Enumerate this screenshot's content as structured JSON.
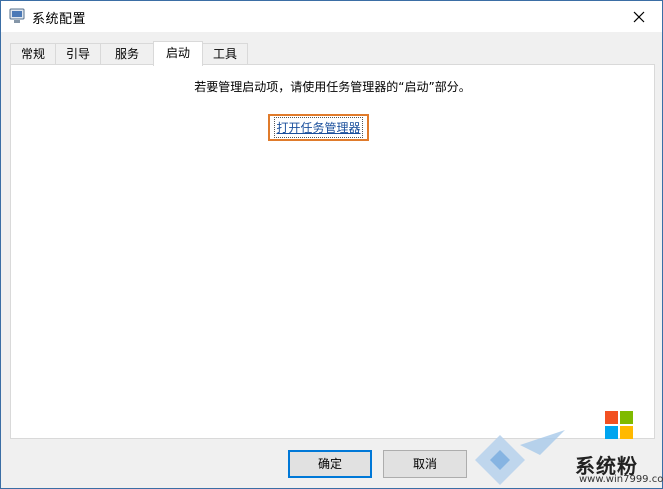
{
  "window": {
    "title": "系统配置"
  },
  "tabs": [
    {
      "label": "常规"
    },
    {
      "label": "引导"
    },
    {
      "label": "服务"
    },
    {
      "label": "启动"
    },
    {
      "label": "工具"
    }
  ],
  "active_tab": "启动",
  "panel": {
    "message": "若要管理启动项，请使用任务管理器的“启动”部分。",
    "link": "打开任务管理器"
  },
  "buttons": {
    "ok": "确定",
    "cancel": "取消"
  },
  "watermark": {
    "text": "系统粉",
    "url": "www.win7999.com"
  },
  "colors": {
    "accent": "#0078d7",
    "highlight_box": "#e07b2b",
    "link": "#1a4f9c"
  }
}
